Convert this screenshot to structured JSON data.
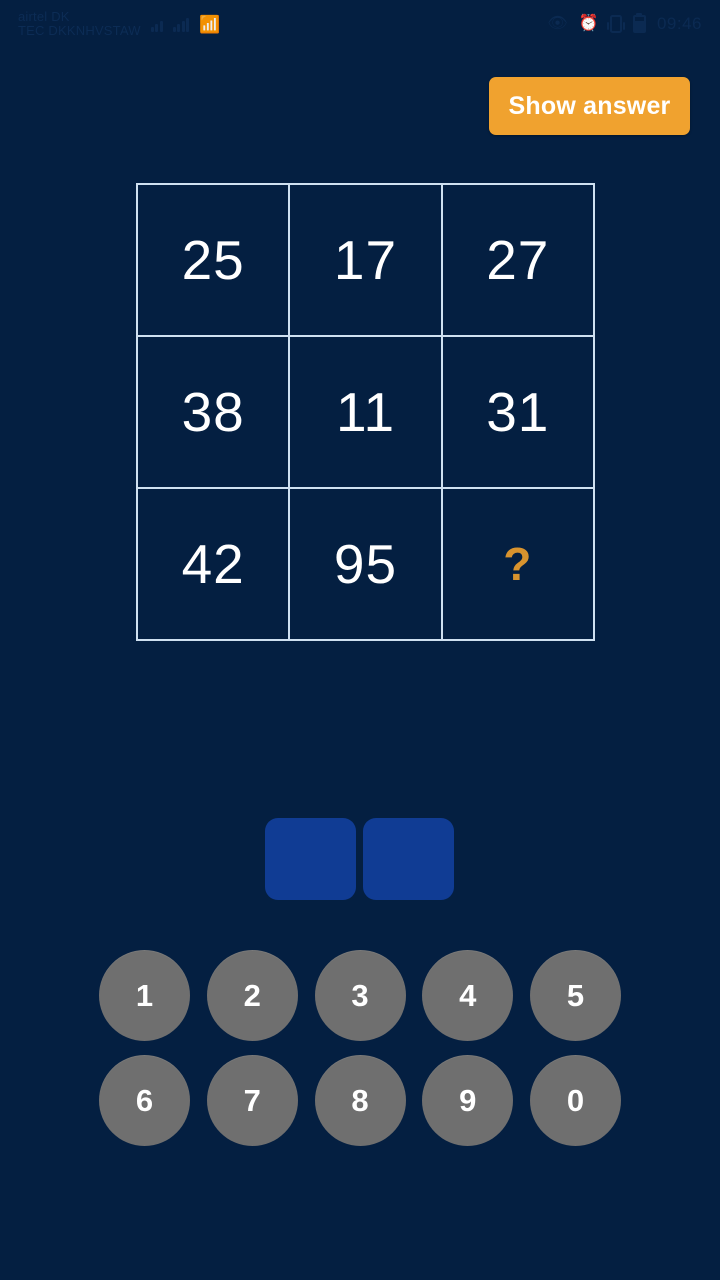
{
  "status_bar": {
    "carrier_line1": "airtel DK",
    "carrier_line2": "TEC DKKNHVSTAW",
    "signal_icon_1": "signal-bars-weak-icon",
    "signal_icon_2": "signal-bars-icon",
    "wifi_icon": "wifi-icon",
    "eye_icon": "eye-icon",
    "alarm_icon": "alarm-clock-icon",
    "vibrate_icon": "vibrate-icon",
    "battery_icon": "battery-icon",
    "time": "09:46",
    "icon_color": "#0b2a52"
  },
  "toolbar": {
    "show_answer_label": "Show answer",
    "accent_color": "#f0a22f"
  },
  "puzzle": {
    "grid_border_color": "#cfe0f0",
    "unknown_color": "#d8932e",
    "rows": [
      [
        "25",
        "17",
        "27"
      ],
      [
        "38",
        "11",
        "31"
      ],
      [
        "42",
        "95",
        "?"
      ]
    ]
  },
  "answer": {
    "slot_color": "#103c94",
    "slots": [
      "",
      ""
    ]
  },
  "keypad": {
    "key_color": "#6f6f6f",
    "rows": [
      [
        "1",
        "2",
        "3",
        "4",
        "5"
      ],
      [
        "6",
        "7",
        "8",
        "9",
        "0"
      ]
    ]
  },
  "theme": {
    "background": "#041f41"
  }
}
